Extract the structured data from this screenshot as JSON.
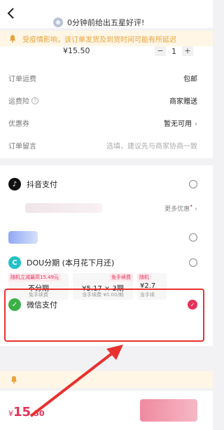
{
  "header": {
    "message": "0分钟前给出五星好评!"
  },
  "notice": {
    "text": "受疫情影响，该订单发货及到货时间可能有所延迟"
  },
  "product": {
    "price": "¥15.50",
    "quantity": "1",
    "minus": "−",
    "plus": "+"
  },
  "order_rows": [
    {
      "label": "订单运费",
      "value": "包邮"
    },
    {
      "label": "运费险",
      "value": "商家赠送"
    },
    {
      "label": "优惠券",
      "value": "暂无可用"
    },
    {
      "label": "订单留言",
      "value": "选填，建议先与商家协商一致"
    }
  ],
  "payment": {
    "douyin": {
      "label": "抖音支付",
      "icon": "douyin-icon"
    },
    "more_promo": "更多优惠",
    "dou_installment": {
      "label": "DOU分期 (本月花下月还)",
      "icon": "dou-icon"
    },
    "plans": [
      {
        "tag": "随机立减最高15.49元",
        "main": "不分期",
        "sub": "免手续费"
      },
      {
        "tag": "免手续费",
        "main": "¥5.17 × 3期",
        "sub": "含手续费 ¥0.00/期"
      },
      {
        "tag": "随机",
        "main": "¥2.7",
        "sub": "含手续"
      }
    ],
    "wechat": {
      "label": "微信支付",
      "icon": "wechat-icon",
      "selected": true
    }
  },
  "footer": {
    "currency": "¥",
    "total_int": "15",
    "total_dec": ".50"
  },
  "colors": {
    "accent": "#e3325a",
    "annotation_red": "#e8312f",
    "notice_text": "#e8a33a"
  }
}
